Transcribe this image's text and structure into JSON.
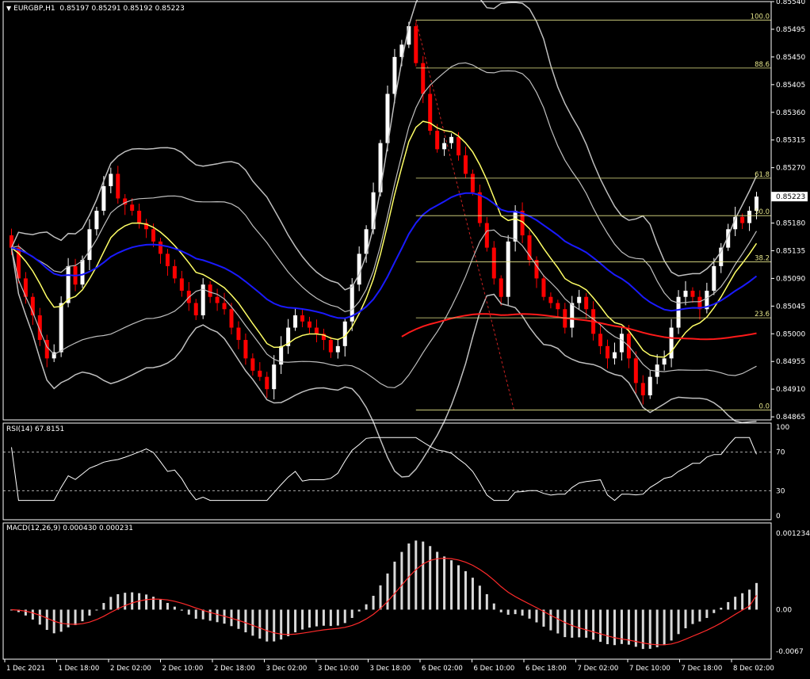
{
  "header": {
    "arrow": "▼",
    "symbol": "EURGBP,H1",
    "ohlc": "0.85197 0.85291 0.85192 0.85223"
  },
  "rsi": {
    "label": "RSI(14) 67.8151",
    "levels": [
      30,
      70
    ],
    "ylim": [
      0,
      100
    ]
  },
  "macd": {
    "label": "MACD(12,26,9) 0.000430 0.000231"
  },
  "colors": {
    "background": "#000000",
    "bull": "#ffffff",
    "bear": "#ff0000",
    "ema_fast": "#ffff66",
    "ema_mid": "#1a1aff",
    "ema_slow": "#ff1a1a",
    "bollinger": "#bfbfbf",
    "fib": "#e6e68a",
    "grid_axis": "#ffffff"
  },
  "chart_data": {
    "type": "candlestick",
    "symbol": "EURGBP",
    "timeframe": "H1",
    "price_ticks": [
      0.8554,
      0.85495,
      0.8545,
      0.85405,
      0.8536,
      0.85315,
      0.8527,
      0.85225,
      0.8518,
      0.85135,
      0.8509,
      0.85045,
      0.85,
      0.84955,
      0.8491,
      0.84865
    ],
    "price_ticks_labels": [
      "0.85540",
      "0.85495",
      "0.85450",
      "0.85405",
      "0.85360",
      "0.85315",
      "0.85270",
      "0.85223",
      "0.85180",
      "0.85135",
      "0.85090",
      "0.85045",
      "0.85000",
      "0.84955",
      "0.84910",
      "0.84865"
    ],
    "ylim": [
      0.8486,
      0.8554
    ],
    "current_price": "0.85223",
    "x_labels": [
      "1 Dec 2021",
      "1 Dec 18:00",
      "2 Dec 02:00",
      "2 Dec 10:00",
      "2 Dec 18:00",
      "3 Dec 02:00",
      "3 Dec 10:00",
      "3 Dec 18:00",
      "6 Dec 02:00",
      "6 Dec 10:00",
      "6 Dec 18:00",
      "7 Dec 02:00",
      "7 Dec 10:00",
      "7 Dec 18:00",
      "8 Dec 02:00"
    ],
    "closes": [
      0.8514,
      0.8509,
      0.8506,
      0.8503,
      0.8499,
      0.8496,
      0.8497,
      0.8505,
      0.8511,
      0.8508,
      0.8512,
      0.8517,
      0.852,
      0.8524,
      0.8526,
      0.8522,
      0.8521,
      0.852,
      0.8518,
      0.8517,
      0.8515,
      0.8513,
      0.8511,
      0.8509,
      0.8507,
      0.8505,
      0.8503,
      0.8508,
      0.8506,
      0.8505,
      0.8504,
      0.8501,
      0.8499,
      0.8496,
      0.8494,
      0.8493,
      0.8491,
      0.8495,
      0.8498,
      0.8501,
      0.8503,
      0.8502,
      0.8501,
      0.85,
      0.8499,
      0.8497,
      0.8498,
      0.8502,
      0.8508,
      0.8513,
      0.8517,
      0.8523,
      0.8531,
      0.8539,
      0.8545,
      0.8547,
      0.855,
      0.8544,
      0.8539,
      0.8533,
      0.853,
      0.8531,
      0.8532,
      0.8529,
      0.8526,
      0.8523,
      0.8518,
      0.8514,
      0.8509,
      0.8506,
      0.8515,
      0.852,
      0.8516,
      0.8512,
      0.8509,
      0.8506,
      0.8505,
      0.8504,
      0.8501,
      0.8505,
      0.8506,
      0.8504,
      0.85,
      0.8498,
      0.8496,
      0.8497,
      0.85,
      0.8496,
      0.8492,
      0.849,
      0.8493,
      0.8495,
      0.8496,
      0.8501,
      0.8506,
      0.8507,
      0.8506,
      0.8504,
      0.8507,
      0.8511,
      0.8514,
      0.8517,
      0.8519,
      0.8518,
      0.852,
      0.85223
    ],
    "fibonacci": {
      "levels": [
        {
          "label": "100.0",
          "price": 0.8551
        },
        {
          "label": "88.6",
          "price": 0.85432
        },
        {
          "label": "61.8",
          "price": 0.85253
        },
        {
          "label": "50.0",
          "price": 0.85192
        },
        {
          "label": "38.2",
          "price": 0.85117
        },
        {
          "label": "23.6",
          "price": 0.85026
        },
        {
          "label": "0.0",
          "price": 0.84876
        }
      ]
    },
    "rsi_value": 67.8151,
    "rsi_ticks": [
      100,
      70,
      30,
      0
    ],
    "rsi_ticks_labels": [
      "100",
      "70",
      "30",
      "0"
    ],
    "macd_value": 0.00043,
    "signal_value": 0.000231,
    "macd_ticks_labels": [
      "0.001234",
      "0.00",
      "-0.0067"
    ],
    "macd_ticks": [
      0.001234,
      0.0,
      -0.00067
    ],
    "macd_ylim": [
      -0.0008,
      0.0014
    ]
  }
}
